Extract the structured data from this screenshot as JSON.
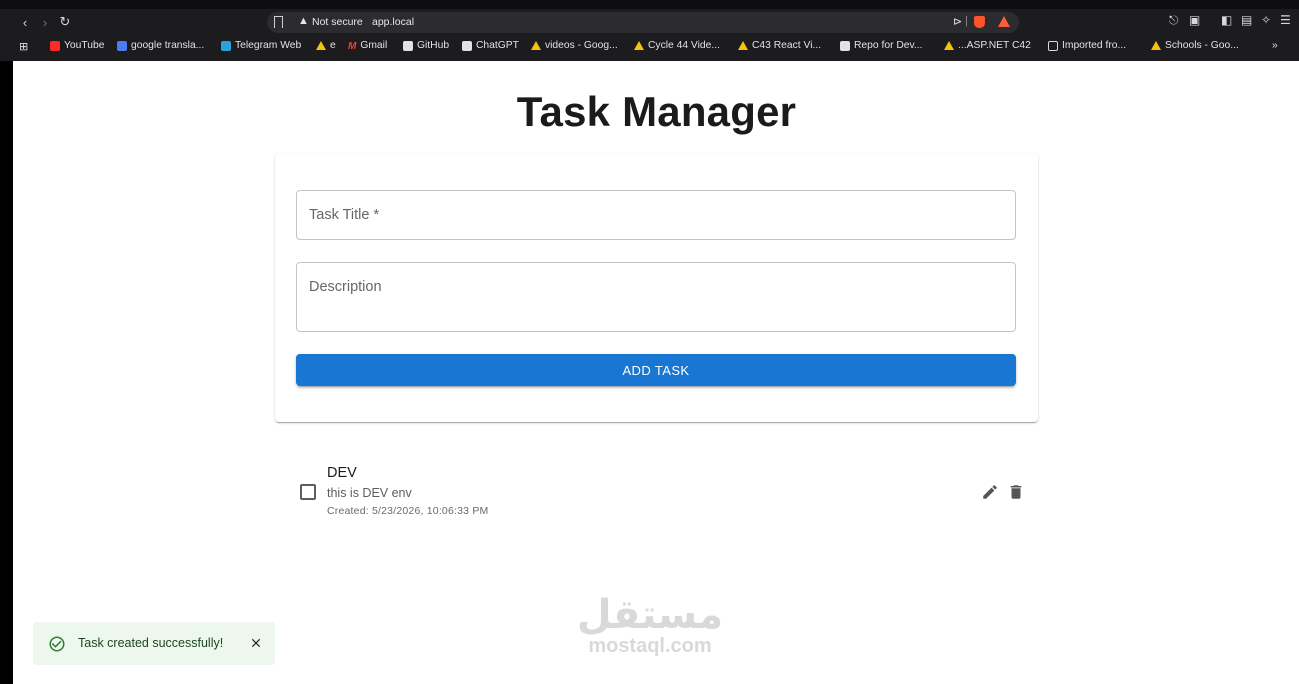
{
  "browser": {
    "security_label": "Not secure",
    "url": "app.local",
    "bookmarks": [
      {
        "label": "YouTube",
        "icon": "youtube-icon"
      },
      {
        "label": "google transla...",
        "icon": "google-translate-icon"
      },
      {
        "label": "Telegram Web",
        "icon": "telegram-icon"
      },
      {
        "label": "e",
        "icon": "google-drive-icon"
      },
      {
        "label": "Gmail",
        "icon": "gmail-icon"
      },
      {
        "label": "GitHub",
        "icon": "github-icon"
      },
      {
        "label": "ChatGPT",
        "icon": "chatgpt-icon"
      },
      {
        "label": "videos - Goog...",
        "icon": "google-drive-icon"
      },
      {
        "label": "Cycle 44 Vide...",
        "icon": "google-drive-icon"
      },
      {
        "label": "C43 React Vi...",
        "icon": "google-drive-icon"
      },
      {
        "label": "Repo for Dev...",
        "icon": "github-icon"
      },
      {
        "label": "...ASP.NET C42",
        "icon": "google-drive-icon"
      },
      {
        "label": "Imported fro...",
        "icon": "folder-icon"
      },
      {
        "label": "Schools - Goo...",
        "icon": "google-drive-icon"
      }
    ],
    "more_bookmarks": "»"
  },
  "app": {
    "title": "Task Manager",
    "form": {
      "title_placeholder": "Task Title *",
      "title_value": "",
      "description_placeholder": "Description",
      "description_value": "",
      "add_button_label": "ADD TASK"
    },
    "tasks": [
      {
        "title": "DEV",
        "description": "this is DEV env",
        "created": "Created: 5/23/2026, 10:06:33 PM",
        "completed": false
      }
    ]
  },
  "watermark": {
    "logo_text": "مستقل",
    "url": "mostaql.com"
  },
  "snackbar": {
    "message": "Task created successfully!",
    "status_color": "#2e7d32"
  },
  "colors": {
    "primary": "#1976d2",
    "snackbar_bg": "#edf7ed",
    "browser_chrome": "#1c1c1f"
  }
}
